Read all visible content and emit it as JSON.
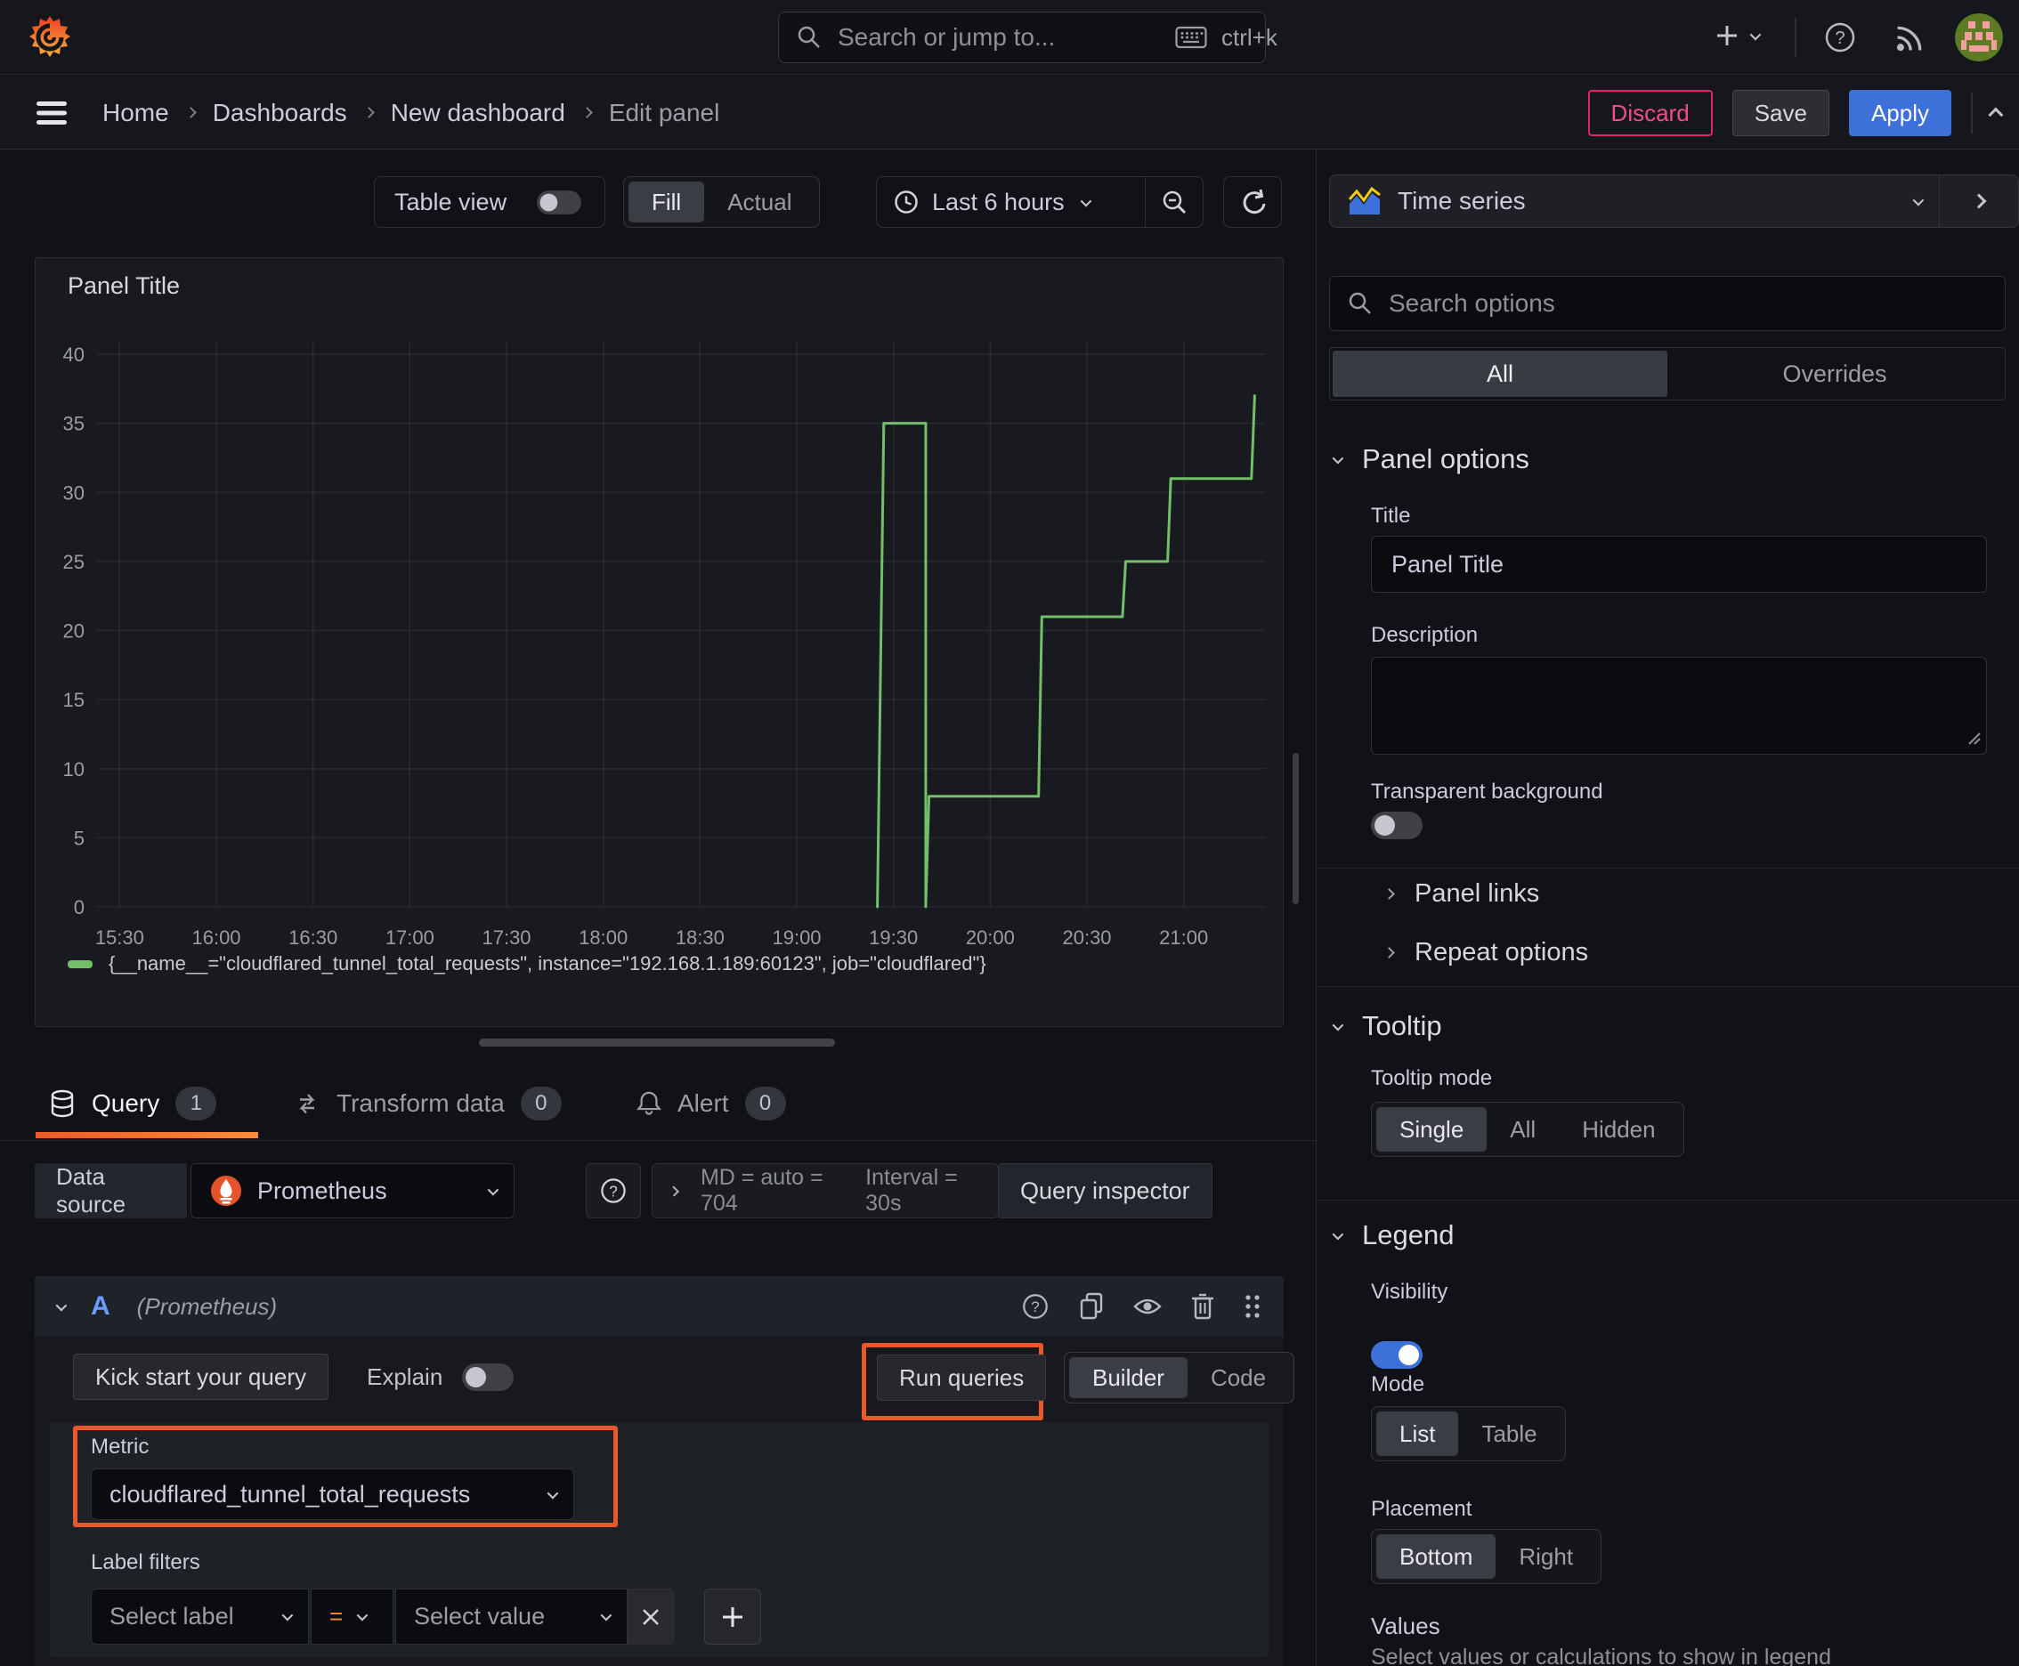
{
  "topbar": {
    "search_placeholder": "Search or jump to...",
    "shortcut": "ctrl+k"
  },
  "breadcrumb": {
    "items": [
      "Home",
      "Dashboards",
      "New dashboard",
      "Edit panel"
    ]
  },
  "actions": {
    "discard": "Discard",
    "save": "Save",
    "apply": "Apply"
  },
  "panel_toolbar": {
    "table_view": "Table view",
    "fill": "Fill",
    "actual": "Actual",
    "time_range": "Last 6 hours"
  },
  "panel": {
    "title": "Panel Title",
    "legend": "{__name__=\"cloudflared_tunnel_total_requests\", instance=\"192.168.1.189:60123\", job=\"cloudflared\"}"
  },
  "chart_data": {
    "type": "line",
    "line_style": "step",
    "title": "Panel Title",
    "series": [
      {
        "name": "{__name__=\"cloudflared_tunnel_total_requests\", instance=\"192.168.1.189:60123\", job=\"cloudflared\"}"
      }
    ],
    "color": "#73bf69",
    "x_range": [
      "15:23",
      "21:23"
    ],
    "x_ticks": [
      "15:30",
      "16:00",
      "16:30",
      "17:00",
      "17:30",
      "18:00",
      "18:30",
      "19:00",
      "19:30",
      "20:00",
      "20:30",
      "21:00"
    ],
    "ylim": [
      0,
      40
    ],
    "y_ticks": [
      0,
      5,
      10,
      15,
      20,
      25,
      30,
      35,
      40
    ],
    "grid": true,
    "legend_position": "bottom",
    "points": [
      {
        "t": "19:25",
        "v": 0
      },
      {
        "t": "19:27",
        "v": 35
      },
      {
        "t": "19:40",
        "v": 35
      },
      {
        "t": "19:40",
        "v": 0
      },
      {
        "t": "19:41",
        "v": 8
      },
      {
        "t": "20:15",
        "v": 8
      },
      {
        "t": "20:16",
        "v": 21
      },
      {
        "t": "20:41",
        "v": 21
      },
      {
        "t": "20:42",
        "v": 25
      },
      {
        "t": "20:55",
        "v": 25
      },
      {
        "t": "20:56",
        "v": 31
      },
      {
        "t": "21:21",
        "v": 31
      },
      {
        "t": "21:22",
        "v": 37
      }
    ]
  },
  "tabs": [
    {
      "label": "Query",
      "badge": "1"
    },
    {
      "label": "Transform data",
      "badge": "0"
    },
    {
      "label": "Alert",
      "badge": "0"
    }
  ],
  "query": {
    "datasource_label": "Data source",
    "datasource": "Prometheus",
    "stats_md": "MD = auto = 704",
    "stats_interval": "Interval = 30s",
    "inspector": "Query inspector",
    "ref_id": "A",
    "ref_ds": "(Prometheus)",
    "kickstart": "Kick start your query",
    "explain": "Explain",
    "run": "Run queries",
    "builder": "Builder",
    "code": "Code",
    "metric_label": "Metric",
    "metric_value": "cloudflared_tunnel_total_requests",
    "label_filters": "Label filters",
    "select_label": "Select label",
    "operator": "=",
    "select_value": "Select value"
  },
  "sidebar": {
    "viz": "Time series",
    "search_placeholder": "Search options",
    "tab_all": "All",
    "tab_overrides": "Overrides",
    "panel_options": {
      "heading": "Panel options",
      "title_label": "Title",
      "title_value": "Panel Title",
      "description_label": "Description",
      "transparent": "Transparent background"
    },
    "collapsed": [
      {
        "label": "Panel links"
      },
      {
        "label": "Repeat options"
      }
    ],
    "tooltip": {
      "heading": "Tooltip",
      "mode_label": "Tooltip mode",
      "options": [
        "Single",
        "All",
        "Hidden"
      ],
      "active": "Single"
    },
    "legend": {
      "heading": "Legend",
      "visibility_label": "Visibility",
      "mode_label": "Mode",
      "mode_options": [
        "List",
        "Table"
      ],
      "mode_active": "List",
      "placement_label": "Placement",
      "placement_options": [
        "Bottom",
        "Right"
      ],
      "placement_active": "Bottom",
      "values_label": "Values",
      "values_desc": "Select values or calculations to show in legend"
    }
  },
  "colors": {
    "highlight_orange": "#e9592b",
    "apply_blue": "#3d71d9",
    "discard_pink": "#e0226e",
    "series_green": "#73bf69",
    "tab_underline": "#f05a28",
    "ref_id_blue": "#6c9bff"
  }
}
